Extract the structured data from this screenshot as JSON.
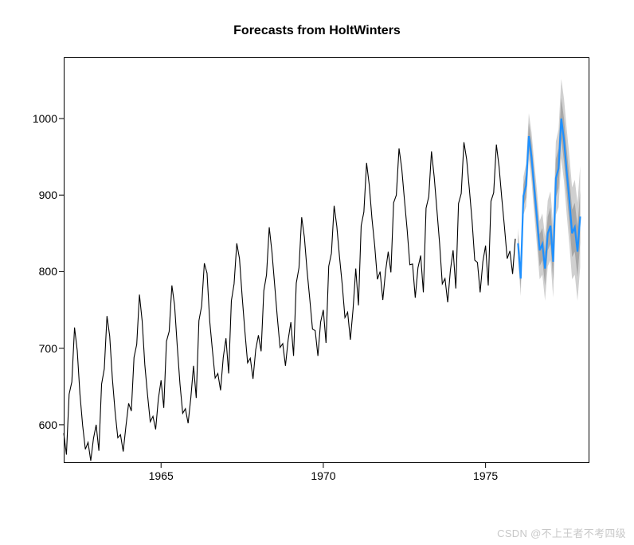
{
  "chart_data": {
    "type": "line",
    "title": "Forecasts from HoltWinters",
    "xlabel": "",
    "ylabel": "",
    "xlim": [
      1962,
      1978.2
    ],
    "ylim": [
      550,
      1080
    ],
    "x_ticks": [
      1965,
      1970,
      1975
    ],
    "y_ticks": [
      600,
      700,
      800,
      900,
      1000
    ],
    "series": [
      {
        "name": "observed",
        "color": "#000000",
        "x_start": 1962.0,
        "x_step": 0.0833333,
        "values": [
          589,
          561,
          640,
          656,
          727,
          697,
          640,
          599,
          568,
          577,
          553,
          582,
          600,
          566,
          653,
          673,
          742,
          716,
          660,
          617,
          583,
          587,
          565,
          598,
          628,
          618,
          688,
          705,
          770,
          736,
          678,
          639,
          604,
          611,
          594,
          634,
          658,
          622,
          709,
          722,
          782,
          756,
          702,
          653,
          615,
          621,
          602,
          635,
          677,
          635,
          736,
          755,
          811,
          798,
          735,
          697,
          661,
          667,
          645,
          688,
          713,
          667,
          762,
          784,
          837,
          817,
          767,
          722,
          681,
          687,
          660,
          698,
          717,
          696,
          775,
          796,
          858,
          826,
          783,
          740,
          701,
          706,
          677,
          711,
          734,
          690,
          785,
          805,
          871,
          845,
          801,
          764,
          725,
          723,
          690,
          734,
          750,
          707,
          807,
          824,
          886,
          859,
          819,
          783,
          740,
          747,
          711,
          751,
          804,
          756,
          860,
          878,
          942,
          913,
          869,
          834,
          790,
          800,
          763,
          800,
          826,
          799,
          890,
          900,
          961,
          935,
          894,
          855,
          809,
          810,
          766,
          805,
          821,
          773,
          883,
          898,
          957,
          924,
          881,
          837,
          784,
          791,
          760,
          802,
          828,
          778,
          889,
          902,
          969,
          947,
          908,
          867,
          815,
          812,
          773,
          813,
          834,
          782,
          892,
          903,
          966,
          937,
          896,
          858,
          817,
          827,
          797,
          843
        ]
      },
      {
        "name": "forecast",
        "color": "#1E90FF",
        "x_start": 1976.0,
        "x_step": 0.0833333,
        "values": [
          837,
          791,
          899,
          913,
          977,
          950,
          909,
          870,
          828,
          836,
          804,
          850,
          860,
          813,
          922,
          935,
          1000,
          972,
          931,
          893,
          850,
          858,
          826,
          872
        ]
      }
    ],
    "prediction_intervals": [
      {
        "name": "hi95",
        "x_start": 1976.0,
        "x_step": 0.0833333,
        "upper": [
          857,
          814,
          924,
          941,
          1007,
          982,
          943,
          906,
          866,
          876,
          846,
          893,
          905,
          860,
          970,
          986,
          1052,
          1026,
          987,
          951,
          910,
          920,
          890,
          938
        ],
        "lower": [
          817,
          768,
          874,
          885,
          947,
          918,
          875,
          834,
          790,
          796,
          762,
          807,
          815,
          766,
          874,
          884,
          948,
          918,
          875,
          835,
          790,
          796,
          762,
          806
        ],
        "fill": "#d0d0d0"
      },
      {
        "name": "hi80",
        "x_start": 1976.0,
        "x_step": 0.0833333,
        "upper": [
          849,
          804,
          913,
          929,
          994,
          968,
          928,
          890,
          849,
          857,
          826,
          872,
          884,
          838,
          947,
          961,
          1027,
          1000,
          960,
          923,
          881,
          890,
          859,
          906
        ],
        "lower": [
          825,
          778,
          885,
          897,
          960,
          932,
          890,
          850,
          807,
          815,
          782,
          828,
          836,
          788,
          897,
          909,
          973,
          944,
          902,
          863,
          819,
          826,
          793,
          838
        ],
        "fill": "#a8a8a8"
      }
    ]
  },
  "watermark": "CSDN @不上王者不考四级"
}
